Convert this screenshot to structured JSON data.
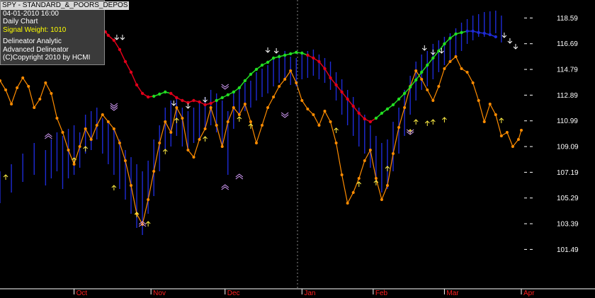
{
  "info": {
    "ticker": "SPY - STANDARD_&_POORS_DEPOS",
    "datetime": "04-01-2010  16:00",
    "chart_type": "Daily Chart",
    "signal_weight": "Signal Weight: 1010",
    "line1": "Delineator Analytic",
    "line2": "Advanced Delineator",
    "copyright": "(C)Copyright 2010 by HCMI"
  },
  "colors": {
    "background": "#000000",
    "price_bars": "#1e2bd6",
    "oscillator": "#ff8c00",
    "trend_down": "#e0001a",
    "trend_up": "#22dd22",
    "axis_text": "#ffffff",
    "month_text": "#ff2020",
    "signal_arrow": "#ffee44",
    "signal_chevron": "#d9a0ff"
  },
  "chart_data": {
    "type": "line",
    "y_ticks": [
      "118.59",
      "116.69",
      "114.79",
      "112.89",
      "110.99",
      "109.09",
      "107.19",
      "105.29",
      "103.39",
      "101.49"
    ],
    "y_tick_values": [
      118.59,
      116.69,
      114.79,
      112.89,
      110.99,
      109.09,
      107.19,
      105.29,
      103.39,
      101.49
    ],
    "ylim": [
      99.0,
      119.5
    ],
    "months": [
      "Oct",
      "Nov",
      "Dec",
      "Jan",
      "Feb",
      "Mar",
      "Apr"
    ],
    "month_start_bar": [
      26,
      53,
      79,
      106,
      131,
      156,
      183
    ],
    "bar_count": 184,
    "oscillator_points": [
      [
        0,
        112
      ],
      [
        2,
        125
      ],
      [
        4,
        145
      ],
      [
        6,
        122
      ],
      [
        8,
        108
      ],
      [
        10,
        120
      ],
      [
        12,
        150
      ],
      [
        14,
        138
      ],
      [
        16,
        115
      ],
      [
        18,
        130
      ],
      [
        20,
        165
      ],
      [
        22,
        185
      ],
      [
        24,
        210
      ],
      [
        26,
        230
      ],
      [
        28,
        205
      ],
      [
        30,
        180
      ],
      [
        32,
        195
      ],
      [
        34,
        175
      ],
      [
        36,
        160
      ],
      [
        38,
        170
      ],
      [
        40,
        180
      ],
      [
        42,
        200
      ],
      [
        44,
        225
      ],
      [
        46,
        260
      ],
      [
        48,
        300
      ],
      [
        50,
        315
      ],
      [
        52,
        280
      ],
      [
        54,
        240
      ],
      [
        56,
        200
      ],
      [
        58,
        170
      ],
      [
        60,
        185
      ],
      [
        62,
        150
      ],
      [
        64,
        165
      ],
      [
        66,
        210
      ],
      [
        68,
        220
      ],
      [
        70,
        195
      ],
      [
        72,
        180
      ],
      [
        74,
        150
      ],
      [
        76,
        175
      ],
      [
        78,
        205
      ],
      [
        80,
        170
      ],
      [
        82,
        150
      ],
      [
        84,
        160
      ],
      [
        86,
        145
      ],
      [
        88,
        170
      ],
      [
        90,
        200
      ],
      [
        92,
        175
      ],
      [
        94,
        150
      ],
      [
        96,
        135
      ],
      [
        98,
        120
      ],
      [
        100,
        110
      ],
      [
        102,
        98
      ],
      [
        104,
        115
      ],
      [
        106,
        140
      ],
      [
        108,
        152
      ],
      [
        110,
        160
      ],
      [
        112,
        175
      ],
      [
        114,
        155
      ],
      [
        116,
        170
      ],
      [
        118,
        200
      ],
      [
        120,
        245
      ],
      [
        122,
        285
      ],
      [
        124,
        270
      ],
      [
        126,
        250
      ],
      [
        128,
        225
      ],
      [
        130,
        210
      ],
      [
        132,
        250
      ],
      [
        134,
        280
      ],
      [
        136,
        260
      ],
      [
        138,
        215
      ],
      [
        140,
        178
      ],
      [
        142,
        150
      ],
      [
        144,
        120
      ],
      [
        146,
        98
      ],
      [
        148,
        110
      ],
      [
        150,
        125
      ],
      [
        152,
        140
      ],
      [
        154,
        120
      ],
      [
        156,
        95
      ],
      [
        158,
        85
      ],
      [
        160,
        78
      ],
      [
        162,
        95
      ],
      [
        164,
        100
      ],
      [
        166,
        115
      ],
      [
        168,
        140
      ],
      [
        170,
        170
      ],
      [
        172,
        145
      ],
      [
        174,
        160
      ],
      [
        176,
        190
      ],
      [
        178,
        185
      ],
      [
        180,
        205
      ],
      [
        182,
        195
      ],
      [
        183,
        182
      ]
    ],
    "trend_points": [
      [
        37,
        43,
        "d"
      ],
      [
        38,
        48,
        "d"
      ],
      [
        40,
        55,
        "d"
      ],
      [
        42,
        68,
        "d"
      ],
      [
        44,
        85,
        "d"
      ],
      [
        46,
        100,
        "d"
      ],
      [
        48,
        118,
        "d"
      ],
      [
        50,
        130,
        "d"
      ],
      [
        52,
        135,
        "d"
      ],
      [
        54,
        134,
        "u"
      ],
      [
        56,
        131,
        "u"
      ],
      [
        58,
        128,
        "u"
      ],
      [
        60,
        130,
        "d"
      ],
      [
        62,
        136,
        "d"
      ],
      [
        64,
        140,
        "d"
      ],
      [
        66,
        143,
        "d"
      ],
      [
        68,
        140,
        "d"
      ],
      [
        70,
        142,
        "d"
      ],
      [
        72,
        146,
        "d"
      ],
      [
        74,
        144,
        "d"
      ],
      [
        76,
        140,
        "u"
      ],
      [
        78,
        136,
        "u"
      ],
      [
        80,
        132,
        "u"
      ],
      [
        82,
        128,
        "u"
      ],
      [
        84,
        122,
        "u"
      ],
      [
        86,
        112,
        "u"
      ],
      [
        88,
        103,
        "u"
      ],
      [
        90,
        96,
        "u"
      ],
      [
        92,
        90,
        "u"
      ],
      [
        94,
        86,
        "u"
      ],
      [
        96,
        80,
        "u"
      ],
      [
        98,
        78,
        "u"
      ],
      [
        100,
        76,
        "u"
      ],
      [
        102,
        74,
        "u"
      ],
      [
        104,
        72,
        "u"
      ],
      [
        106,
        73,
        "u"
      ],
      [
        108,
        76,
        "d"
      ],
      [
        110,
        80,
        "d"
      ],
      [
        112,
        85,
        "d"
      ],
      [
        114,
        95,
        "d"
      ],
      [
        116,
        108,
        "d"
      ],
      [
        118,
        118,
        "d"
      ],
      [
        120,
        128,
        "d"
      ],
      [
        122,
        138,
        "d"
      ],
      [
        124,
        148,
        "d"
      ],
      [
        126,
        158,
        "d"
      ],
      [
        128,
        166,
        "d"
      ],
      [
        130,
        170,
        "d"
      ],
      [
        132,
        165,
        "u"
      ],
      [
        134,
        158,
        "u"
      ],
      [
        136,
        152,
        "u"
      ],
      [
        138,
        146,
        "u"
      ],
      [
        140,
        138,
        "u"
      ],
      [
        142,
        130,
        "u"
      ],
      [
        144,
        121,
        "u"
      ],
      [
        146,
        111,
        "u"
      ],
      [
        148,
        100,
        "u"
      ],
      [
        150,
        90,
        "u"
      ],
      [
        152,
        80,
        "u"
      ],
      [
        154,
        70,
        "u"
      ],
      [
        156,
        60,
        "u"
      ],
      [
        158,
        52,
        "u"
      ],
      [
        160,
        46,
        "u"
      ],
      [
        162,
        44,
        "u"
      ],
      [
        164,
        42,
        "b"
      ],
      [
        166,
        42,
        "b"
      ],
      [
        168,
        44,
        "b"
      ],
      [
        170,
        45,
        "b"
      ],
      [
        172,
        47,
        "b"
      ],
      [
        174,
        50,
        "b"
      ]
    ],
    "price_bars": [
      [
        0,
        240,
        285
      ],
      [
        4,
        230,
        270
      ],
      [
        8,
        215,
        255
      ],
      [
        12,
        200,
        245
      ],
      [
        16,
        210,
        260
      ],
      [
        18,
        195,
        250
      ],
      [
        20,
        185,
        240
      ],
      [
        22,
        190,
        265
      ],
      [
        24,
        180,
        250
      ],
      [
        26,
        175,
        245
      ],
      [
        28,
        185,
        235
      ],
      [
        30,
        160,
        215
      ],
      [
        32,
        155,
        210
      ],
      [
        34,
        150,
        195
      ],
      [
        36,
        165,
        215
      ],
      [
        38,
        170,
        230
      ],
      [
        40,
        180,
        245
      ],
      [
        42,
        195,
        265
      ],
      [
        44,
        210,
        280
      ],
      [
        46,
        220,
        300
      ],
      [
        48,
        230,
        320
      ],
      [
        50,
        240,
        330
      ],
      [
        52,
        225,
        300
      ],
      [
        54,
        195,
        275
      ],
      [
        56,
        175,
        240
      ],
      [
        58,
        150,
        210
      ],
      [
        60,
        140,
        205
      ],
      [
        62,
        135,
        190
      ],
      [
        64,
        150,
        205
      ],
      [
        66,
        155,
        210
      ],
      [
        68,
        150,
        200
      ],
      [
        70,
        140,
        195
      ],
      [
        72,
        135,
        180
      ],
      [
        74,
        125,
        175
      ],
      [
        76,
        130,
        185
      ],
      [
        78,
        140,
        205
      ],
      [
        80,
        155,
        245
      ],
      [
        82,
        130,
        180
      ],
      [
        84,
        120,
        160
      ],
      [
        86,
        115,
        155
      ],
      [
        88,
        112,
        150
      ],
      [
        90,
        100,
        140
      ],
      [
        92,
        95,
        135
      ],
      [
        94,
        90,
        130
      ],
      [
        96,
        80,
        120
      ],
      [
        98,
        75,
        115
      ],
      [
        100,
        70,
        110
      ],
      [
        102,
        78,
        118
      ],
      [
        104,
        80,
        120
      ],
      [
        106,
        75,
        110
      ],
      [
        108,
        70,
        108
      ],
      [
        110,
        68,
        105
      ],
      [
        112,
        75,
        110
      ],
      [
        114,
        80,
        115
      ],
      [
        116,
        85,
        125
      ],
      [
        118,
        100,
        140
      ],
      [
        120,
        110,
        160
      ],
      [
        122,
        125,
        175
      ],
      [
        124,
        135,
        190
      ],
      [
        126,
        150,
        205
      ],
      [
        128,
        160,
        215
      ],
      [
        130,
        175,
        235
      ],
      [
        132,
        190,
        255
      ],
      [
        134,
        200,
        270
      ],
      [
        136,
        195,
        265
      ],
      [
        138,
        170,
        240
      ],
      [
        140,
        150,
        215
      ],
      [
        142,
        125,
        190
      ],
      [
        144,
        105,
        160
      ],
      [
        146,
        85,
        140
      ],
      [
        148,
        75,
        125
      ],
      [
        150,
        70,
        120
      ],
      [
        152,
        60,
        110
      ],
      [
        154,
        55,
        100
      ],
      [
        156,
        50,
        90
      ],
      [
        158,
        45,
        85
      ],
      [
        160,
        38,
        78
      ],
      [
        162,
        30,
        70
      ],
      [
        164,
        25,
        60
      ],
      [
        166,
        20,
        55
      ],
      [
        168,
        18,
        50
      ],
      [
        170,
        15,
        50
      ],
      [
        172,
        14,
        48
      ],
      [
        174,
        13,
        45
      ],
      [
        176,
        20,
        58
      ]
    ],
    "arrows_down": [
      [
        41,
        47
      ],
      [
        43,
        47
      ],
      [
        61,
        140
      ],
      [
        66,
        144
      ],
      [
        72,
        135
      ],
      [
        94,
        65
      ],
      [
        97,
        66
      ],
      [
        149,
        62
      ],
      [
        152,
        68
      ],
      [
        155,
        66
      ],
      [
        177,
        44
      ],
      [
        179,
        52
      ],
      [
        181,
        60
      ]
    ],
    "arrows_up": [
      [
        2,
        252
      ],
      [
        26,
        228
      ],
      [
        30,
        212
      ],
      [
        40,
        267
      ],
      [
        48,
        305
      ],
      [
        52,
        318
      ],
      [
        58,
        216
      ],
      [
        62,
        172
      ],
      [
        72,
        198
      ],
      [
        84,
        170
      ],
      [
        88,
        180
      ],
      [
        118,
        186
      ],
      [
        126,
        262
      ],
      [
        132,
        260
      ],
      [
        136,
        240
      ],
      [
        144,
        188
      ],
      [
        146,
        174
      ],
      [
        150,
        176
      ],
      [
        152,
        174
      ],
      [
        156,
        171
      ],
      [
        176,
        172
      ]
    ],
    "chevrons": [
      [
        17,
        188,
        "up"
      ],
      [
        50,
        312,
        "up"
      ],
      [
        40,
        147,
        "down"
      ],
      [
        40,
        150,
        "down"
      ],
      [
        79,
        120,
        "down"
      ],
      [
        84,
        245,
        "up"
      ],
      [
        79,
        260,
        "up"
      ],
      [
        100,
        160,
        "down"
      ],
      [
        144,
        184,
        "down"
      ]
    ]
  }
}
